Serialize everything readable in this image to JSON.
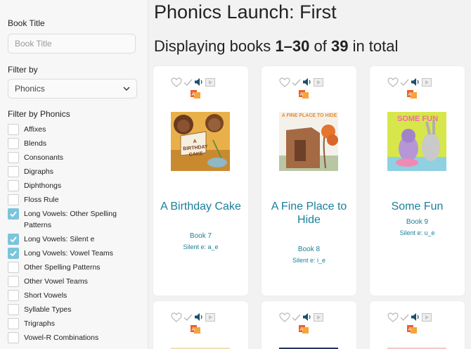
{
  "sidebar": {
    "book_title_label": "Book Title",
    "book_title_placeholder": "Book Title",
    "filter_by_label": "Filter by",
    "filter_by_value": "Phonics",
    "filter_phonics_label": "Filter by Phonics",
    "filters": [
      {
        "label": "Affixes",
        "checked": false
      },
      {
        "label": "Blends",
        "checked": false
      },
      {
        "label": "Consonants",
        "checked": false
      },
      {
        "label": "Digraphs",
        "checked": false
      },
      {
        "label": "Diphthongs",
        "checked": false
      },
      {
        "label": "Floss Rule",
        "checked": false
      },
      {
        "label": "Long Vowels: Other Spelling Patterns",
        "checked": true
      },
      {
        "label": "Long Vowels: Silent e",
        "checked": true
      },
      {
        "label": "Long Vowels: Vowel Teams",
        "checked": true
      },
      {
        "label": "Other Spelling Patterns",
        "checked": false
      },
      {
        "label": "Other Vowel Teams",
        "checked": false
      },
      {
        "label": "Short Vowels",
        "checked": false
      },
      {
        "label": "Syllable Types",
        "checked": false
      },
      {
        "label": "Trigraphs",
        "checked": false
      },
      {
        "label": "Vowel-R Combinations",
        "checked": false
      }
    ]
  },
  "main": {
    "title": "Phonics Launch: First",
    "display_prefix": "Displaying books ",
    "display_range": "1–30",
    "display_mid": " of ",
    "display_total": "39",
    "display_suffix": " in total",
    "books": [
      {
        "title": "A Birthday Cake",
        "number": "Book 7",
        "phonics": "Silent e: a_e",
        "cover_text": "A BIRTHDAY CAKE"
      },
      {
        "title": "A Fine Place to Hide",
        "number": "Book 8",
        "phonics": "Silent e: i_e",
        "cover_text": "A FINE PLACE TO HIDE"
      },
      {
        "title": "Some Fun",
        "number": "Book 9",
        "phonics": "Silent e: u_e",
        "cover_text": "SOME FUN"
      }
    ],
    "icon_names": [
      "heart-icon",
      "check-icon",
      "speaker-icon",
      "video-icon",
      "abc-icon"
    ],
    "colors": {
      "accent": "#1b7f99",
      "checkbox_on": "#7cc4dc"
    }
  }
}
